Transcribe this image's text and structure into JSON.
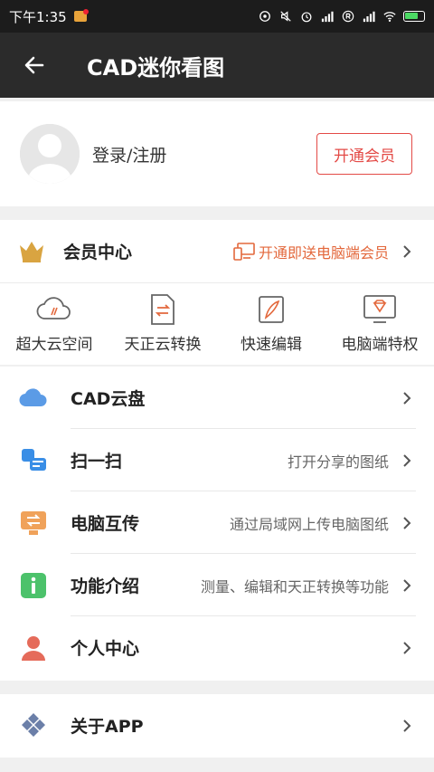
{
  "status_bar": {
    "time": "下午1:35",
    "icons": [
      "app-notification-icon",
      "hotspot-icon",
      "mute-icon",
      "alarm-icon",
      "signal-icon",
      "registered-icon",
      "signal-icon",
      "wifi-icon",
      "battery-charging-icon"
    ]
  },
  "app_bar": {
    "title": "CAD迷你看图",
    "back_icon": "back-arrow-icon"
  },
  "profile": {
    "login_label": "登录/注册",
    "vip_button": "开通会员"
  },
  "member_center": {
    "label": "会员中心",
    "promo": "开通即送电脑端会员",
    "features": [
      {
        "label": "超大云空间",
        "icon": "cloud-storage-icon"
      },
      {
        "label": "天正云转换",
        "icon": "file-convert-icon"
      },
      {
        "label": "快速编辑",
        "icon": "edit-icon"
      },
      {
        "label": "电脑端特权",
        "icon": "desktop-privilege-icon"
      }
    ]
  },
  "menu": [
    {
      "label": "CAD云盘",
      "desc": "",
      "icon": "cloud-icon"
    },
    {
      "label": "扫一扫",
      "desc": "打开分享的图纸",
      "icon": "scan-icon"
    },
    {
      "label": "电脑互传",
      "desc": "通过局域网上传电脑图纸",
      "icon": "transfer-icon"
    },
    {
      "label": "功能介绍",
      "desc": "测量、编辑和天正转换等功能",
      "icon": "info-icon"
    },
    {
      "label": "个人中心",
      "desc": "",
      "icon": "person-icon"
    }
  ],
  "about": {
    "label": "关于APP",
    "icon": "diamond-grid-icon"
  },
  "colors": {
    "accent_red": "#e34a46",
    "promo_orange": "#e3683c",
    "crown_gold": "#d9a441",
    "app_bar_bg": "#2b2b2b"
  }
}
